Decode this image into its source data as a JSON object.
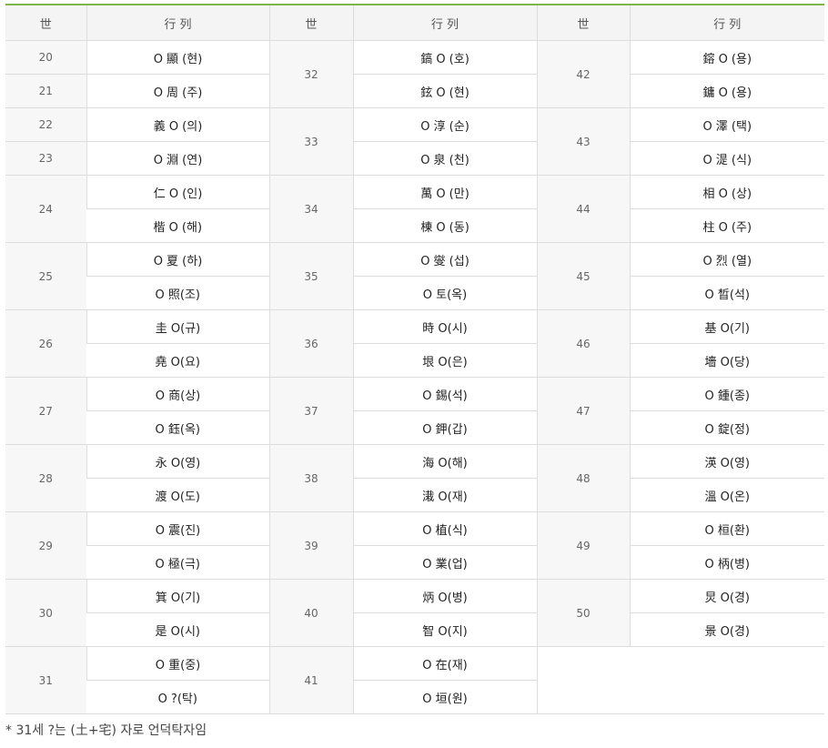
{
  "header": {
    "col_gen": "世",
    "col_row": "行 列"
  },
  "columns": [
    {
      "items": [
        {
          "gen": "20",
          "names": [
            "O 顯 (현)"
          ]
        },
        {
          "gen": "21",
          "names": [
            "O 周 (주)"
          ]
        },
        {
          "gen": "22",
          "names": [
            "義 O (의)"
          ]
        },
        {
          "gen": "23",
          "names": [
            "O 淵 (연)"
          ]
        },
        {
          "gen": "24",
          "names": [
            "仁 O (인)",
            "楷 O (해)"
          ]
        },
        {
          "gen": "25",
          "names": [
            "O 夏 (하)",
            "O 照(조)"
          ]
        },
        {
          "gen": "26",
          "names": [
            "圭 O(규)",
            "堯 O(요)"
          ]
        },
        {
          "gen": "27",
          "names": [
            "O 商(상)",
            "O 鈺(옥)"
          ]
        },
        {
          "gen": "28",
          "names": [
            "永 O(영)",
            "渡 O(도)"
          ]
        },
        {
          "gen": "29",
          "names": [
            "O 震(진)",
            "O 極(극)"
          ]
        },
        {
          "gen": "30",
          "names": [
            "箕 O(기)",
            "是 O(시)"
          ]
        },
        {
          "gen": "31",
          "names": [
            "O 重(중)",
            "O ?(탁)"
          ]
        }
      ]
    },
    {
      "items": [
        {
          "gen": "32",
          "names": [
            "鎬 O (호)",
            "鉉 O (현)"
          ]
        },
        {
          "gen": "33",
          "names": [
            "O 淳 (순)",
            "O 泉 (천)"
          ]
        },
        {
          "gen": "34",
          "names": [
            "萬 O (만)",
            "棟 O (동)"
          ]
        },
        {
          "gen": "35",
          "names": [
            "O 燮 (섭)",
            "O 토(옥)"
          ]
        },
        {
          "gen": "36",
          "names": [
            "時 O(시)",
            "垠 O(은)"
          ]
        },
        {
          "gen": "37",
          "names": [
            "O 錫(석)",
            "O 鉀(갑)"
          ]
        },
        {
          "gen": "38",
          "names": [
            "海 O(해)",
            "溨 O(재)"
          ]
        },
        {
          "gen": "39",
          "names": [
            "O 植(식)",
            "O 業(업)"
          ]
        },
        {
          "gen": "40",
          "names": [
            "炳 O(병)",
            "智 O(지)"
          ]
        },
        {
          "gen": "41",
          "names": [
            "O 在(재)",
            "O 垣(원)"
          ]
        }
      ]
    },
    {
      "items": [
        {
          "gen": "42",
          "names": [
            "鎔 O (용)",
            "鏞 O (용)"
          ]
        },
        {
          "gen": "43",
          "names": [
            "O 澤 (택)",
            "O 湜 (식)"
          ]
        },
        {
          "gen": "44",
          "names": [
            "相 O (상)",
            "柱 O (주)"
          ]
        },
        {
          "gen": "45",
          "names": [
            "O 烈 (열)",
            "O 晳(석)"
          ]
        },
        {
          "gen": "46",
          "names": [
            "基 O(기)",
            "墻 O(당)"
          ]
        },
        {
          "gen": "47",
          "names": [
            "O 鍾(종)",
            "O 錠(정)"
          ]
        },
        {
          "gen": "48",
          "names": [
            "渶 O(영)",
            "溫 O(온)"
          ]
        },
        {
          "gen": "49",
          "names": [
            "O 桓(환)",
            "O 柄(병)"
          ]
        },
        {
          "gen": "50",
          "names": [
            "炅 O(경)",
            "景 O(경)"
          ]
        }
      ]
    }
  ],
  "footnote": "* 31세 ?는 (土+宅) 자로 언덕탁자임"
}
